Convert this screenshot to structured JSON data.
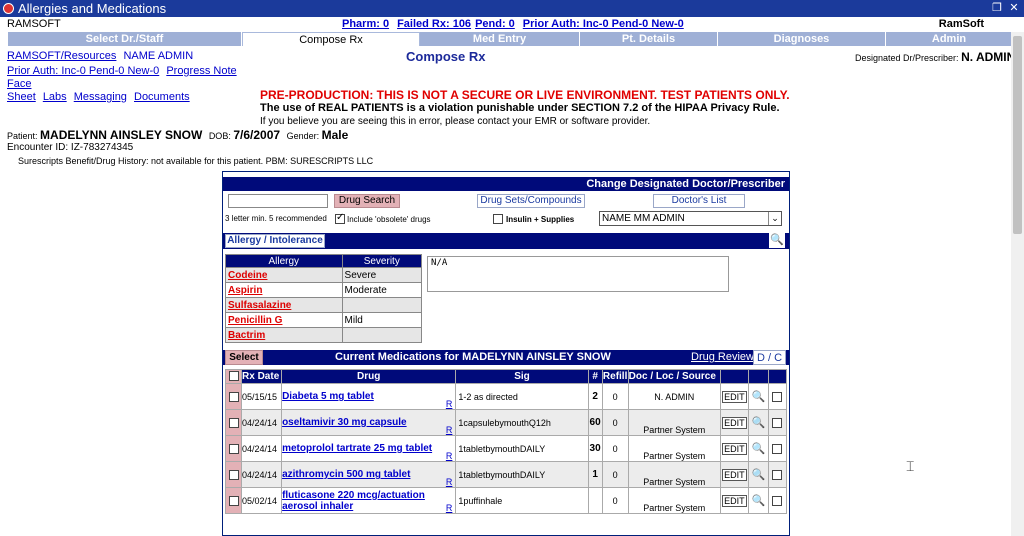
{
  "window": {
    "title": "Allergies and Medications"
  },
  "top": {
    "org": "RAMSOFT",
    "brand": "RamSoft",
    "status_links": [
      "Pharm: 0",
      "Failed Rx: 106",
      "Pend: 0",
      "Prior Auth: Inc-0 Pend-0 New-0"
    ]
  },
  "tabs": [
    "Select Dr./Staff",
    "Compose Rx",
    "Med Entry",
    "Pt. Details",
    "Diagnoses",
    "Admin"
  ],
  "side_links": {
    "resources": "RAMSOFT/Resources",
    "name_admin": "NAME ADMIN",
    "prior_auth": "Prior Auth: Inc-0 Pend-0 New-0",
    "progress_note": "Progress Note",
    "face": "Face",
    "sheet": "Sheet",
    "labs": "Labs",
    "messaging": "Messaging",
    "documents": "Documents"
  },
  "heading": "Compose Rx",
  "prescriber": {
    "label": "Designated Dr/Prescriber:",
    "name": "N. ADMIN"
  },
  "warnings": {
    "line1": "PRE-PRODUCTION: THIS IS NOT A SECURE OR LIVE ENVIRONMENT. TEST PATIENTS ONLY.",
    "line2": "The use of REAL PATIENTS is a violation punishable under SECTION 7.2 of the HIPAA Privacy Rule.",
    "line3": "If you believe you are seeing this in error, please contact your EMR or software provider."
  },
  "patient": {
    "label": "Patient:",
    "name": "MADELYNN AINSLEY SNOW",
    "dob_label": "DOB:",
    "dob": "7/6/2007",
    "gender_label": "Gender:",
    "gender": "Male",
    "encounter": "Encounter ID: IZ-783274345",
    "benefit": "Surescripts Benefit/Drug History: not available for this patient. PBM: SURESCRIPTS LLC"
  },
  "panel": {
    "header": "Change Designated Doctor/Prescriber",
    "drug_search": "Drug Search",
    "drug_sets": "Drug Sets/Compounds",
    "doctors_list": "Doctor's List",
    "hint": "3 letter min. 5 recommended",
    "include_obsolete": "Include 'obsolete' drugs",
    "insulin": "Insulin + Supplies",
    "doctor_select": "NAME MM ADMIN",
    "allergy_button": "Allergy / Intolerance",
    "allergy_headers": [
      "Allergy",
      "Severity"
    ],
    "allergies": [
      {
        "name": "Codeine",
        "severity": "Severe"
      },
      {
        "name": "Aspirin",
        "severity": "Moderate"
      },
      {
        "name": "Sulfasalazine",
        "severity": ""
      },
      {
        "name": "Penicillin G",
        "severity": "Mild"
      },
      {
        "name": "Bactrim",
        "severity": ""
      }
    ],
    "allergy_text": "N/A",
    "select_btn": "Select",
    "current_meds_label": "Current Medications for  MADELYNN AINSLEY SNOW",
    "drug_review": "Drug Review",
    "dc": "D / C",
    "med_headers": [
      "Rx Date",
      "Drug",
      "Sig",
      "#",
      "Refill",
      "Doc / Loc / Source"
    ],
    "edit_label": "EDIT",
    "r_label": "R",
    "meds": [
      {
        "date": "05/15/15",
        "drug": "Diabeta 5 mg tablet",
        "sig": "1-2 as directed",
        "qty": "2",
        "refill": "0",
        "source": "N. ADMIN"
      },
      {
        "date": "04/24/14",
        "drug": "oseltamivir 30 mg capsule",
        "sig": "1capsulebymouthQ12h",
        "qty": "60",
        "refill": "0",
        "source": "Partner System"
      },
      {
        "date": "04/24/14",
        "drug": "metoprolol tartrate 25 mg tablet",
        "sig": "1tabletbymouthDAILY",
        "qty": "30",
        "refill": "0",
        "source": "Partner System"
      },
      {
        "date": "04/24/14",
        "drug": "azithromycin 500 mg tablet",
        "sig": "1tabletbymouthDAILY",
        "qty": "1",
        "refill": "0",
        "source": "Partner System"
      },
      {
        "date": "05/02/14",
        "drug": "fluticasone 220 mcg/actuation aerosol inhaler",
        "sig": "1puffinhale",
        "qty": "",
        "refill": "0",
        "source": "Partner System"
      }
    ]
  }
}
